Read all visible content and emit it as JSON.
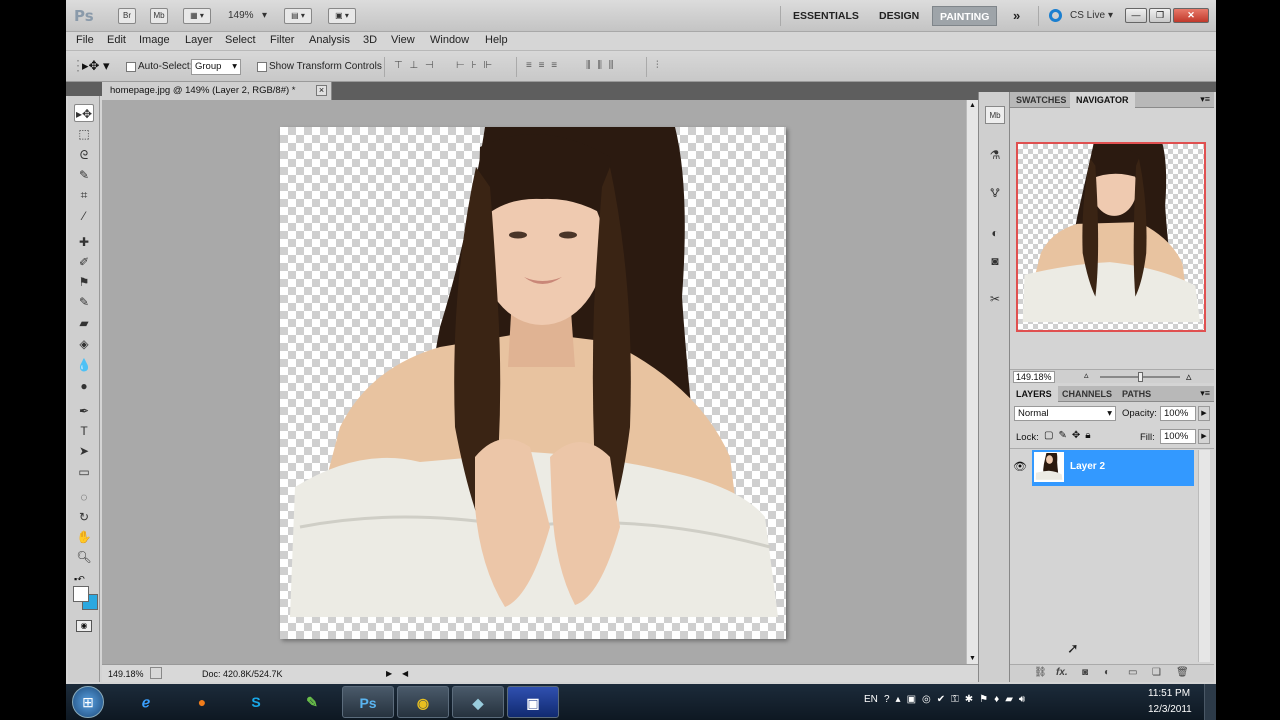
{
  "appbar": {
    "logo": "Ps",
    "bridge": "Br",
    "minibridge": "Mb",
    "zoom": "149%",
    "workspaces": [
      "ESSENTIALS",
      "DESIGN",
      "PAINTING"
    ],
    "active_workspace": "PAINTING",
    "more": "»",
    "cslive": "CS Live"
  },
  "menu": [
    "File",
    "Edit",
    "Image",
    "Layer",
    "Select",
    "Filter",
    "Analysis",
    "3D",
    "View",
    "Window",
    "Help"
  ],
  "options": {
    "auto_select_label": "Auto-Select:",
    "auto_select_value": "Group",
    "transform_label": "Show Transform Controls"
  },
  "document": {
    "tab_title": "homepage.jpg @ 149% (Layer 2, RGB/8#) *",
    "close": "×",
    "zoom": "149.18%",
    "doc_size": "Doc: 420.8K/524.7K"
  },
  "navigator": {
    "tabs": [
      "SWATCHES",
      "NAVIGATOR"
    ],
    "active_tab": "NAVIGATOR",
    "zoom": "149.18%",
    "frame_color": "#e05050"
  },
  "layers": {
    "tabs": [
      "LAYERS",
      "CHANNELS",
      "PATHS"
    ],
    "active_tab": "LAYERS",
    "blend_mode": "Normal",
    "opacity_label": "Opacity:",
    "opacity_value": "100%",
    "lock_label": "Lock:",
    "fill_label": "Fill:",
    "fill_value": "100%",
    "items": [
      {
        "name": "Layer 2",
        "visible": true,
        "selected": true
      }
    ],
    "footer_fx": "fx."
  },
  "colors": {
    "selection": "#3399ff",
    "foreground": "#ffffff",
    "background": "#2aa8e0"
  },
  "taskbar": {
    "ps_label": "Ps",
    "lang": "EN",
    "time": "11:51 PM",
    "date": "12/3/2011"
  }
}
